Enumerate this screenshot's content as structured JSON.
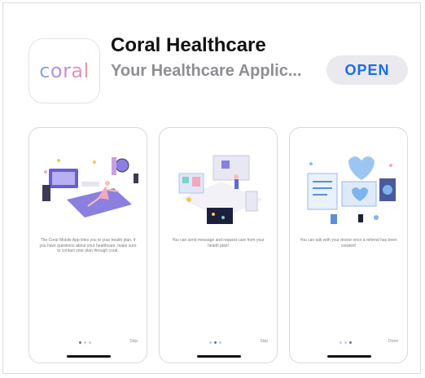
{
  "app": {
    "icon_text": "coral",
    "title": "Coral Healthcare",
    "subtitle": "Your Healthcare Applic...",
    "open_label": "OPEN"
  },
  "screenshots": [
    {
      "caption": "The Coral Mobile App links you to your health plan, if you have questions about your healthcare, make sure to contact your plan through coral.",
      "action_label": "Skip"
    },
    {
      "caption": "You can send message and request care from your health plan!",
      "action_label": "Skip"
    },
    {
      "caption": "You can talk with your doctor once a referral has been created!",
      "action_label": "Done"
    }
  ],
  "colors": {
    "accent": "#1b6ee6",
    "button_bg": "#e9e9ee",
    "subtitle": "#8e8e93",
    "dot_active": "#5b6bd9",
    "dot_inactive": "#c7cbe8"
  }
}
